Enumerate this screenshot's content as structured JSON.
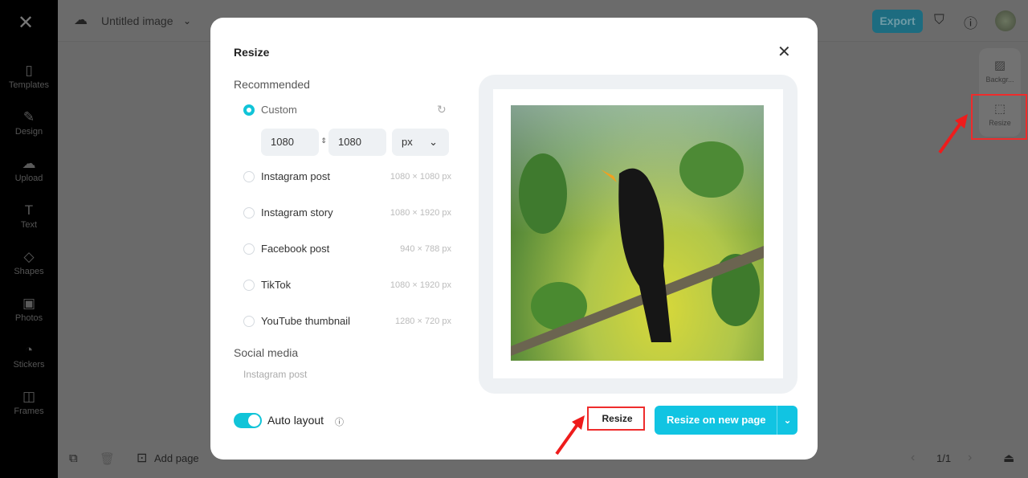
{
  "app": {
    "title": "Untitled image",
    "export_label": "Export"
  },
  "sidebar": {
    "items": [
      {
        "label": "Templates",
        "icon": "templates-icon"
      },
      {
        "label": "Design",
        "icon": "design-icon"
      },
      {
        "label": "Upload",
        "icon": "upload-icon"
      },
      {
        "label": "Text",
        "icon": "text-icon"
      },
      {
        "label": "Shapes",
        "icon": "shapes-icon"
      },
      {
        "label": "Photos",
        "icon": "photos-icon"
      },
      {
        "label": "Stickers",
        "icon": "stickers-icon"
      },
      {
        "label": "Frames",
        "icon": "frames-icon"
      }
    ]
  },
  "right_panel": {
    "items": [
      {
        "label": "Backgr..."
      },
      {
        "label": "Resize"
      }
    ]
  },
  "bottom": {
    "add_page": "Add page",
    "page_indicator": "1/1"
  },
  "modal": {
    "title": "Resize",
    "recommended_label": "Recommended",
    "custom": {
      "label": "Custom",
      "width": "1080",
      "height": "1080",
      "unit": "px",
      "selected": true
    },
    "presets": [
      {
        "label": "Instagram post",
        "size": "1080 × 1080 px"
      },
      {
        "label": "Instagram story",
        "size": "1080 × 1920 px"
      },
      {
        "label": "Facebook post",
        "size": "940 × 788 px"
      },
      {
        "label": "TikTok",
        "size": "1080 × 1920 px"
      },
      {
        "label": "YouTube thumbnail",
        "size": "1280 × 720 px"
      }
    ],
    "social_media_label": "Social media",
    "social_media_items": [
      "Instagram post"
    ],
    "auto_layout": {
      "label": "Auto layout",
      "on": true
    },
    "resize_button": "Resize",
    "resize_new_page_button": "Resize on new page"
  },
  "colors": {
    "accent": "#11c4e2",
    "annotation": "#ee2c2c"
  }
}
